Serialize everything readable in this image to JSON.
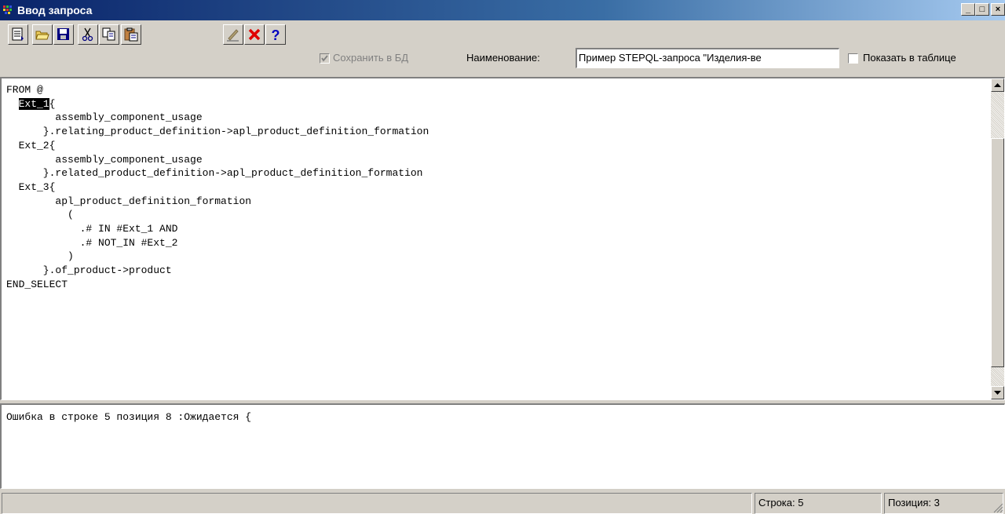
{
  "window": {
    "title": "Ввод запроса",
    "controls": {
      "minimize": "_",
      "maximize": "□",
      "close": "×"
    }
  },
  "toolbar": {
    "buttons": [
      {
        "icon": "list-icon"
      },
      {
        "icon": "open-folder-icon"
      },
      {
        "icon": "save-icon"
      },
      {
        "icon": "cut-icon"
      },
      {
        "icon": "copy-icon"
      },
      {
        "icon": "paste-icon"
      },
      {
        "icon": "edit-pen-icon"
      },
      {
        "icon": "delete-x-icon"
      },
      {
        "icon": "help-icon"
      }
    ],
    "save_to_db": {
      "label": "Сохранить в БД",
      "checked": true,
      "disabled": true
    },
    "name_label": "Наименование:",
    "name_value": "Пример STEPQL-запроса \"Изделия-ве",
    "show_in_table": {
      "label": "Показать в таблице",
      "checked": false
    }
  },
  "editor": {
    "selected_text": "Ext_1",
    "line1": "FROM @",
    "line2_prefix": "  ",
    "line2_suffix": "{",
    "rest": "        assembly_component_usage\n      }.relating_product_definition->apl_product_definition_formation\n  Ext_2{\n        assembly_component_usage\n      }.related_product_definition->apl_product_definition_formation\n  Ext_3{\n        apl_product_definition_formation\n          (\n            .# IN #Ext_1 AND\n            .# NOT_IN #Ext_2\n          )\n      }.of_product->product\nEND_SELECT"
  },
  "errors": {
    "message": "Ошибка в строке 5 позиция 8 :Ожидается {"
  },
  "status": {
    "line": "Строка: 5",
    "position": "Позиция: 3"
  }
}
